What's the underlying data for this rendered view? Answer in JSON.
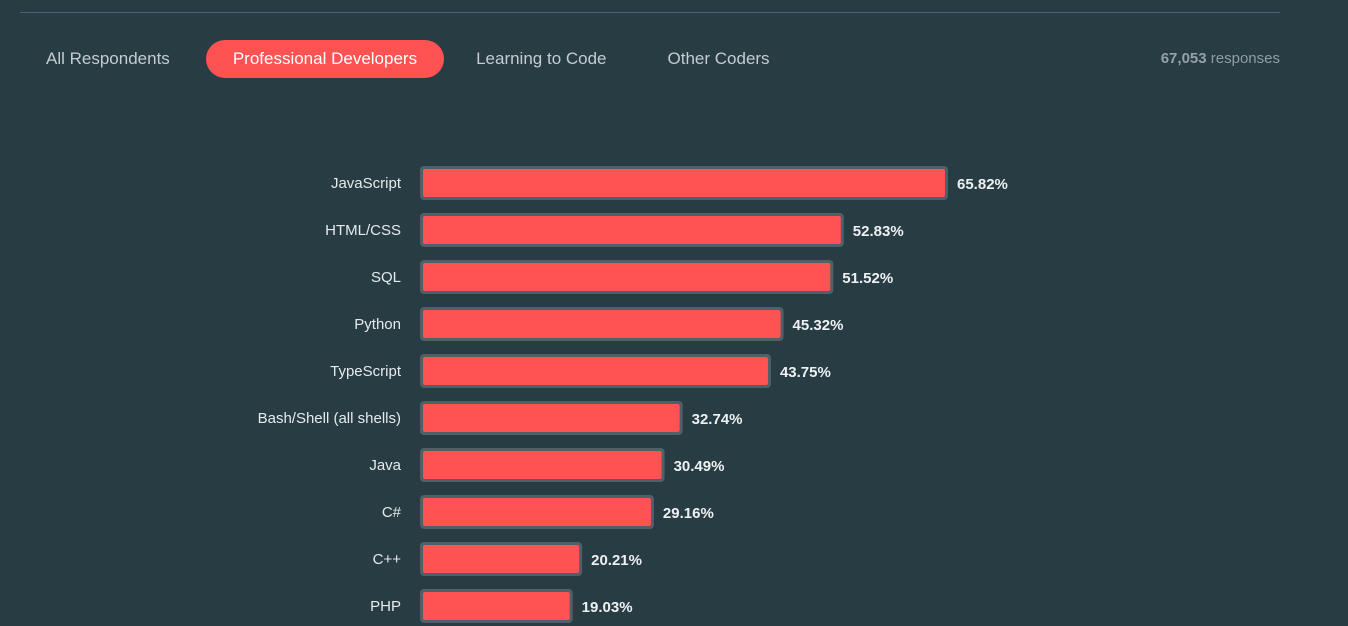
{
  "header": {
    "tabs": [
      {
        "label": "All Respondents",
        "active": false
      },
      {
        "label": "Professional Developers",
        "active": true
      },
      {
        "label": "Learning to Code",
        "active": false
      },
      {
        "label": "Other Coders",
        "active": false
      }
    ],
    "responses_count": "67,053",
    "responses_label": "responses"
  },
  "colors": {
    "background": "#283c44",
    "accent": "#ff5252",
    "bar_border": "#4f6069"
  },
  "chart_data": {
    "type": "bar",
    "orientation": "horizontal",
    "title": "",
    "xlabel": "",
    "ylabel": "",
    "unit": "%",
    "xlim": [
      0,
      65.82
    ],
    "grid": false,
    "legend": "none",
    "categories": [
      "JavaScript",
      "HTML/CSS",
      "SQL",
      "Python",
      "TypeScript",
      "Bash/Shell (all shells)",
      "Java",
      "C#",
      "C++",
      "PHP"
    ],
    "values": [
      65.82,
      52.83,
      51.52,
      45.32,
      43.75,
      32.74,
      30.49,
      29.16,
      20.21,
      19.03
    ],
    "value_labels": [
      "65.82%",
      "52.83%",
      "51.52%",
      "45.32%",
      "43.75%",
      "32.74%",
      "30.49%",
      "29.16%",
      "20.21%",
      "19.03%"
    ]
  }
}
